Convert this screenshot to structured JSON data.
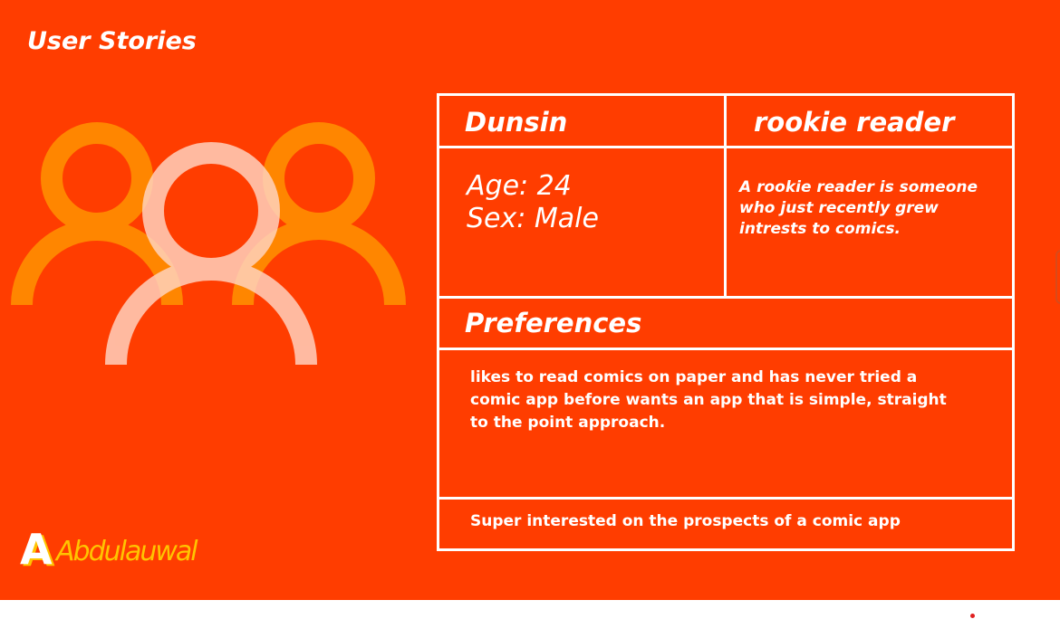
{
  "slide": {
    "title": "User Stories",
    "background_color": "#ff3d00",
    "accent_colors": {
      "figure_side": "#ff8a00",
      "figure_center": "#ffc7b0",
      "logo": "#ffc400"
    }
  },
  "persona": {
    "name": "Dunsin",
    "type": "rookie reader",
    "age": "Age: 24",
    "sex": "Sex: Male",
    "description": "A rookie reader is someone who just recently grew intrests to comics."
  },
  "preferences": {
    "title": "Preferences",
    "text": "likes to read comics on paper and has never tried a comic app before wants an app that is simple, straight to the point approach.",
    "extra": "Super interested on the prospects of a comic app"
  },
  "logo": {
    "text": "Abdulauwal",
    "icon": "abdulauwal-logo"
  },
  "icons": {
    "illustration": "users-group-icon"
  }
}
